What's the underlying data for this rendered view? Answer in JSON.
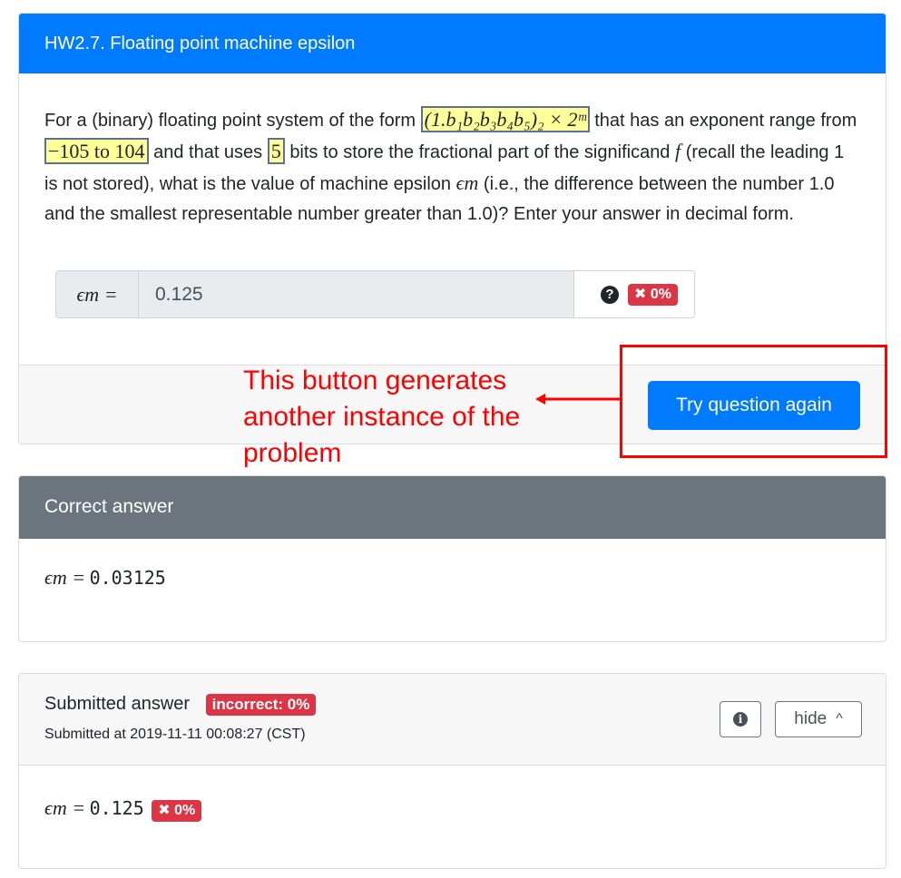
{
  "question_card": {
    "title": "HW2.7. Floating point machine epsilon",
    "text_1": "For a (binary) floating point system of the form",
    "form_expr": "(1.b₁b₂b₃b₄b₅)₂ × 2ᵐ",
    "text_2": "that has an exponent range from",
    "exponent_range": "−105 to 104",
    "text_3": "and that uses",
    "bits": "5",
    "text_4": "bits to store the fractional part of the significand",
    "var_f": "f",
    "text_5": "(recall the leading 1 is not stored), what is the value of machine epsilon",
    "var_eps": "ϵm",
    "text_6": "(i.e., the difference between the number 1.0 and the smallest representable number greater than 1.0)? Enter your answer in decimal form.",
    "input_label": "ϵm =",
    "input_value": "0.125",
    "help_icon_glyph": "?",
    "score_badge": "✖ 0%",
    "try_again_label": "Try question again"
  },
  "annotation": {
    "text": "This button generates another instance of the problem",
    "color": "#ff0000"
  },
  "correct_card": {
    "title": "Correct answer",
    "lhs": "ϵm =",
    "value": "0.03125"
  },
  "submitted_card": {
    "title": "Submitted answer",
    "status_badge": "incorrect: 0%",
    "submitted_at": "Submitted at 2019-11-11 00:08:27 (CST)",
    "info_glyph": "i",
    "hide_label": "hide",
    "hide_caret": "^",
    "lhs": "ϵm =",
    "value": "0.125",
    "score_badge": "✖ 0%"
  },
  "colors": {
    "primary": "#007bff",
    "danger": "#dc3545",
    "header_gray": "#6c757d",
    "highlight": "#ffff99"
  }
}
